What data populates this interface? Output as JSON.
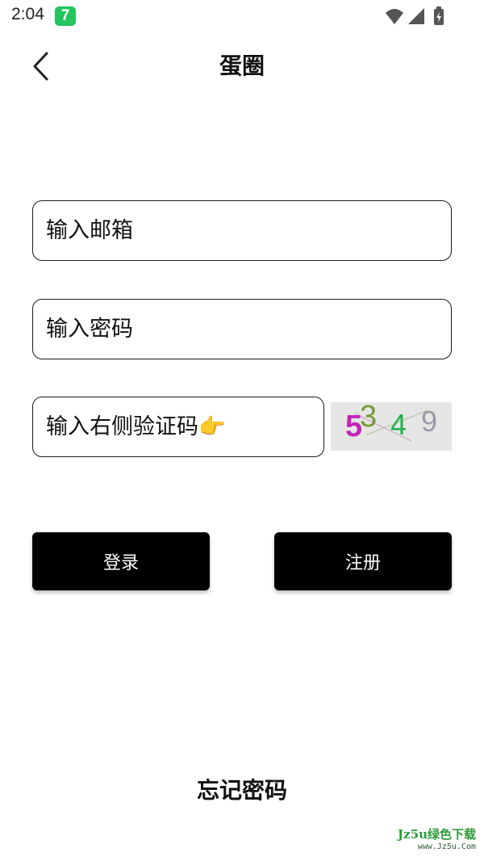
{
  "status_bar": {
    "time": "2:04",
    "app_badge": "7",
    "icons": [
      "wifi-icon",
      "cellular-signal-icon",
      "battery-charging-icon"
    ]
  },
  "header": {
    "title": "蛋圈",
    "back_icon": "chevron-left-icon"
  },
  "form": {
    "email_placeholder": "输入邮箱",
    "password_placeholder": "输入密码",
    "captcha_placeholder": "输入右侧验证码👉",
    "captcha_code": "5349"
  },
  "actions": {
    "login_label": "登录",
    "register_label": "注册",
    "forgot_label": "忘记密码"
  },
  "watermark": {
    "line1": "Jz5u绿色下载",
    "line2": "www.Jz5u.Com"
  },
  "colors": {
    "background": "#ffffff",
    "button_bg": "#000000",
    "button_text": "#ffffff",
    "badge_green": "#22c55e",
    "captcha_bg": "#e6e6e6"
  }
}
